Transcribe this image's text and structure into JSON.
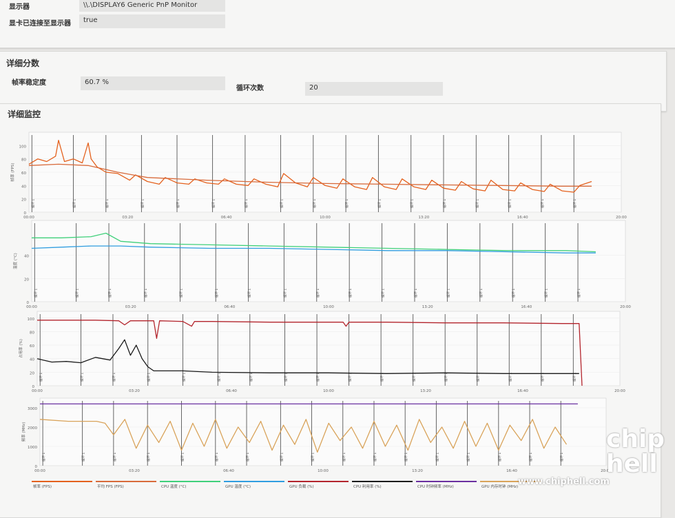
{
  "display_card": {
    "display_label": "显示器",
    "display_value": "\\\\.\\DISPLAY6 Generic PnP Monitor",
    "connected_label": "显卡已连接至显示器",
    "connected_value": "true"
  },
  "score_card": {
    "title": "详细分数",
    "stability_label": "帧率稳定度",
    "stability_value": "60.7 %",
    "loops_label": "循环次数",
    "loops_value": "20"
  },
  "monitor": {
    "title": "详细监控",
    "loop_marker_label": "循环 1",
    "x_ticks": [
      "00:00",
      "03:20",
      "06:40",
      "10:00",
      "13:20",
      "16:40",
      "20:00"
    ]
  },
  "legend": [
    {
      "name": "帧率 (FPS)",
      "color": "#e4601c"
    },
    {
      "name": "平均 FPS (FPS)",
      "color": "#d86a3a"
    },
    {
      "name": "CPU 温度 (°C)",
      "color": "#3fd07a"
    },
    {
      "name": "GPU 温度 (°C)",
      "color": "#2f9de0"
    },
    {
      "name": "GPU 负载 (%)",
      "color": "#b3242c"
    },
    {
      "name": "CPU 利用率 (%)",
      "color": "#1a1a1a"
    },
    {
      "name": "CPU 时钟频率 (MHz)",
      "color": "#6a2fa0"
    },
    {
      "name": "GPU 内存时钟 (MHz)",
      "color": "#d9a35a"
    }
  ],
  "chart_data": [
    {
      "type": "line",
      "ylabel": "帧率 (FPS)",
      "ylim": [
        0,
        120
      ],
      "yticks": [
        0,
        20,
        40,
        60,
        80,
        100
      ],
      "xlim": [
        0,
        20
      ],
      "series": [
        {
          "name": "帧率 (FPS)",
          "color": "#e4601c",
          "x": [
            0,
            0.3,
            0.6,
            0.9,
            1.0,
            1.2,
            1.5,
            1.8,
            2.0,
            2.1,
            2.3,
            2.6,
            3.0,
            3.4,
            3.6,
            4.0,
            4.4,
            4.6,
            5.0,
            5.4,
            5.6,
            6.0,
            6.4,
            6.6,
            7.0,
            7.4,
            7.6,
            8.0,
            8.4,
            8.6,
            9.0,
            9.4,
            9.6,
            10.0,
            10.4,
            10.6,
            11.0,
            11.4,
            11.6,
            12.0,
            12.4,
            12.6,
            13.0,
            13.4,
            13.6,
            14.0,
            14.4,
            14.6,
            15.0,
            15.4,
            15.6,
            16.0,
            16.4,
            16.6,
            17.0,
            17.4,
            17.6,
            18.0,
            18.4,
            18.6,
            19.0
          ],
          "values": [
            72,
            80,
            76,
            84,
            108,
            76,
            80,
            74,
            104,
            80,
            68,
            60,
            58,
            48,
            56,
            46,
            42,
            52,
            44,
            42,
            50,
            44,
            42,
            50,
            42,
            40,
            50,
            42,
            38,
            58,
            44,
            38,
            52,
            40,
            36,
            50,
            38,
            34,
            52,
            38,
            34,
            50,
            38,
            34,
            48,
            36,
            33,
            46,
            35,
            32,
            48,
            34,
            32,
            44,
            34,
            31,
            42,
            32,
            30,
            40,
            46
          ]
        },
        {
          "name": "平均 FPS (FPS)",
          "color": "#d86a3a",
          "x": [
            0,
            1,
            2,
            3,
            4,
            6,
            8,
            10,
            12,
            14,
            16,
            18,
            19
          ],
          "values": [
            70,
            72,
            70,
            60,
            52,
            48,
            45,
            43,
            42,
            41,
            40,
            39,
            39
          ]
        }
      ]
    },
    {
      "type": "line",
      "ylabel": "温度 (°C)",
      "ylim": [
        0,
        70
      ],
      "yticks": [
        0,
        20,
        40
      ],
      "xlim": [
        0,
        20
      ],
      "series": [
        {
          "name": "CPU 温度 (°C)",
          "color": "#3fd07a",
          "x": [
            0,
            1,
            2,
            2.5,
            3,
            4,
            6,
            8,
            10,
            12,
            14,
            16,
            18,
            19
          ],
          "values": [
            55,
            55,
            56,
            59,
            52,
            50,
            49,
            48,
            47,
            46,
            45,
            44,
            44,
            43
          ]
        },
        {
          "name": "GPU 温度 (°C)",
          "color": "#2f9de0",
          "x": [
            0,
            1,
            2,
            3,
            4,
            6,
            8,
            10,
            12,
            14,
            16,
            18,
            19
          ],
          "values": [
            46,
            47,
            48,
            48,
            47,
            46,
            46,
            45,
            44,
            44,
            43,
            42,
            42
          ]
        }
      ]
    },
    {
      "type": "line",
      "ylabel": "占用率 (%)",
      "ylim": [
        0,
        110
      ],
      "yticks": [
        0,
        20,
        40,
        60,
        80,
        100
      ],
      "xlim": [
        0,
        20
      ],
      "series": [
        {
          "name": "GPU 负载 (%)",
          "color": "#b3242c",
          "x": [
            0,
            2,
            2.8,
            3,
            3.2,
            4,
            4.1,
            4.2,
            5,
            5.3,
            5.4,
            6,
            8,
            10,
            10.5,
            10.6,
            10.7,
            12,
            14,
            16,
            18,
            18.6,
            18.7
          ],
          "values": [
            97,
            97,
            96,
            90,
            96,
            96,
            70,
            96,
            95,
            88,
            95,
            95,
            94,
            94,
            94,
            88,
            94,
            94,
            93,
            93,
            92,
            92,
            0
          ]
        },
        {
          "name": "CPU 利用率 (%)",
          "color": "#1a1a1a",
          "x": [
            0,
            0.5,
            1,
            1.5,
            2,
            2.5,
            2.8,
            3.0,
            3.2,
            3.4,
            3.6,
            3.8,
            4,
            5,
            6,
            8,
            10,
            12,
            14,
            16,
            18,
            18.6
          ],
          "values": [
            40,
            35,
            36,
            34,
            42,
            38,
            55,
            68,
            45,
            60,
            40,
            28,
            22,
            22,
            20,
            19,
            19,
            18,
            19,
            18,
            18,
            18
          ]
        }
      ]
    },
    {
      "type": "line",
      "ylabel": "频率 (MHz)",
      "ylim": [
        0,
        3500
      ],
      "yticks": [
        0,
        1000,
        2000,
        3000
      ],
      "xlim": [
        0,
        20
      ],
      "series": [
        {
          "name": "CPU 时钟频率 (MHz)",
          "color": "#6a2fa0",
          "x": [
            0,
            5,
            10,
            15,
            19
          ],
          "values": [
            3200,
            3200,
            3200,
            3200,
            3200
          ]
        },
        {
          "name": "GPU 内存时钟 (MHz)",
          "color": "#d9a35a",
          "x": [
            0,
            1,
            2,
            2.3,
            2.6,
            3,
            3.4,
            3.8,
            4.2,
            4.6,
            5,
            5.4,
            5.8,
            6.2,
            6.6,
            7,
            7.4,
            7.8,
            8.2,
            8.6,
            9,
            9.4,
            9.8,
            10.2,
            10.6,
            11,
            11.4,
            11.8,
            12.2,
            12.6,
            13,
            13.4,
            13.8,
            14.2,
            14.6,
            15,
            15.4,
            15.8,
            16.2,
            16.6,
            17,
            17.4,
            17.8,
            18.2,
            18.6
          ],
          "values": [
            2400,
            2300,
            2300,
            2200,
            1600,
            2400,
            900,
            2100,
            1200,
            2300,
            800,
            2200,
            1000,
            2400,
            900,
            2000,
            1200,
            2300,
            800,
            2100,
            1100,
            2400,
            700,
            2200,
            1300,
            2000,
            900,
            2300,
            1000,
            2100,
            800,
            2400,
            1200,
            2000,
            900,
            2300,
            1000,
            2200,
            800,
            2100,
            1300,
            2400,
            900,
            2000,
            1100
          ]
        }
      ]
    }
  ]
}
